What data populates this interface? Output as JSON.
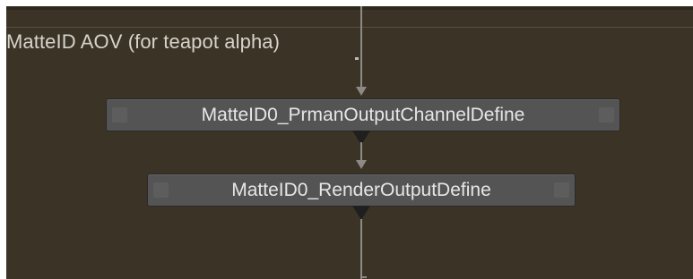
{
  "backdrop": {
    "title": "MatteID AOV (for teapot alpha)",
    "color": "#3b3326"
  },
  "nodes": [
    {
      "id": "prman-output-channel-define",
      "label": "MatteID0_PrmanOutputChannelDefine"
    },
    {
      "id": "render-output-define",
      "label": "MatteID0_RenderOutputDefine"
    }
  ],
  "colors": {
    "node_fill": "#545454",
    "node_text": "#e6e6e6",
    "wire": "#8d8a85",
    "backdrop_text": "#d7d3cb"
  }
}
